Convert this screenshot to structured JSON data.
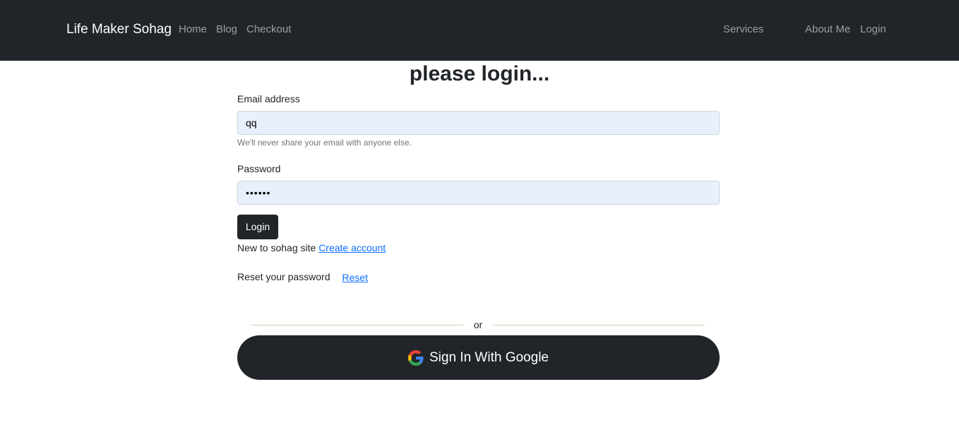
{
  "navbar": {
    "brand": "Life Maker Sohag",
    "links_left": [
      "Home",
      "Blog",
      "Checkout"
    ],
    "links_right": [
      "Services",
      "About Me",
      "Login"
    ]
  },
  "page": {
    "heading": "please login..."
  },
  "form": {
    "email_label": "Email address",
    "email_value": "qq",
    "email_help": "We'll never share your email with anyone else.",
    "password_label": "Password",
    "password_value": "••••••",
    "login_button": "Login"
  },
  "signup": {
    "text": "New to sohag site",
    "link": "Create account"
  },
  "reset": {
    "text": "Reset your password",
    "link": "Reset"
  },
  "divider": {
    "text": "or"
  },
  "google": {
    "label": "Sign In With Google",
    "icon": "google-icon"
  },
  "colors": {
    "navbar_bg": "#212529",
    "input_bg": "#e8f0fe",
    "link": "#0d6efd"
  }
}
